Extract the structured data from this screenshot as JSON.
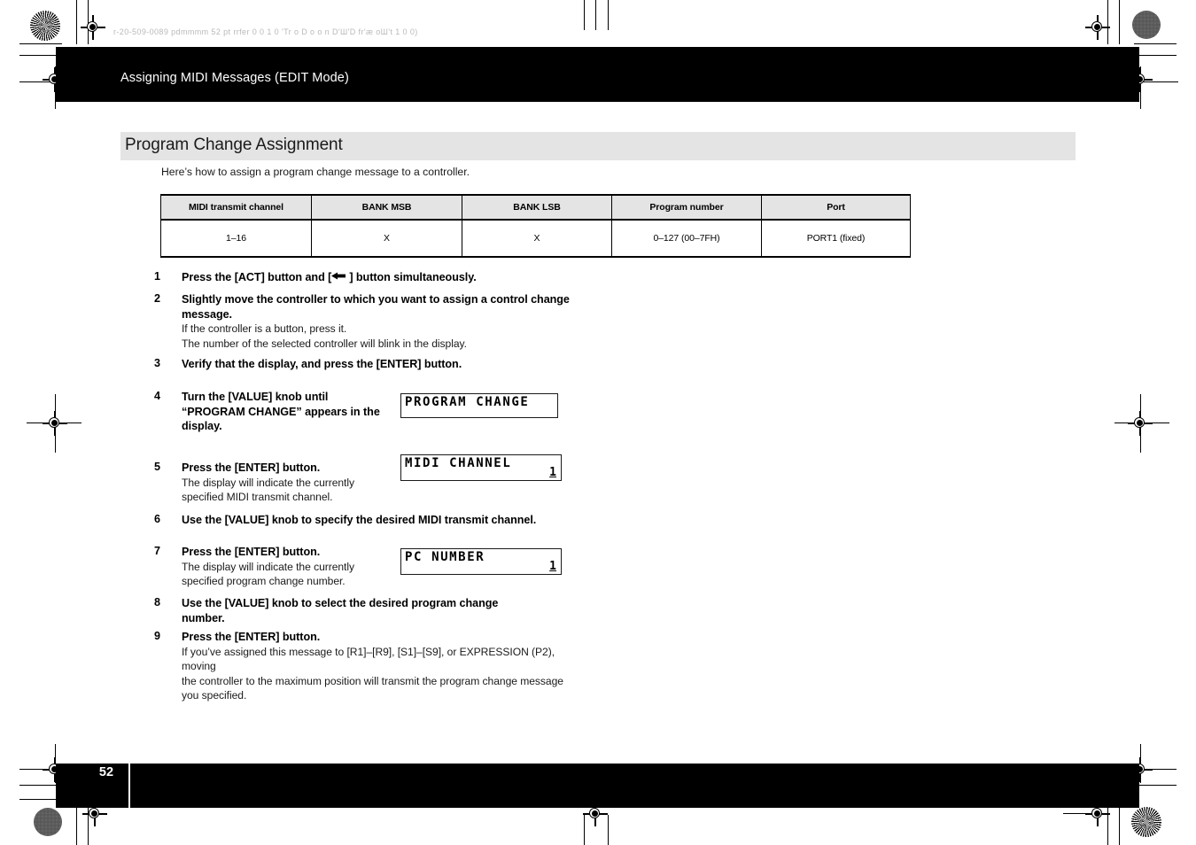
{
  "header": {
    "title": "Assigning MIDI Messages (EDIT Mode)",
    "faint_line": "r-20-509-0089    pdmmmm 52 pt rrfer   0 0 1 0 'Tr o D o o n   D'Ш'D   fr'æ oШ't 1 0 0)"
  },
  "footer": {
    "page_number": "52"
  },
  "section": {
    "title": "Program Change Assignment",
    "intro": "Here’s how to assign a program change message to a controller."
  },
  "spec_table": {
    "headers": [
      "MIDI transmit channel",
      "BANK MSB",
      "BANK LSB",
      "Program number",
      "Port"
    ],
    "rows": [
      [
        "1–16",
        "X",
        "X",
        "0–127 (00–7FH)",
        "PORT1 (fixed)"
      ]
    ]
  },
  "steps": [
    {
      "num": "1",
      "head_before": "Press the [ACT] button and [",
      "icon": "left-triangle-arrow",
      "head_after": "] button simultaneously.",
      "sub": []
    },
    {
      "num": "2",
      "head": "Slightly move the controller to which you want to assign a control change message.",
      "sub": [
        "If the controller is a button, press it.",
        "The number of the selected controller will blink in the display."
      ]
    },
    {
      "num": "3",
      "head": "Verify that the display, and press the [ENTER] button.",
      "sub": []
    },
    {
      "num": "4",
      "head": "Turn the [VALUE] knob until “PROGRAM CHANGE” appears in the display.",
      "sub": []
    },
    {
      "num": "5",
      "head": "Press the [ENTER] button.",
      "sub": [
        "The display will indicate the currently",
        "specified MIDI transmit channel."
      ]
    },
    {
      "num": "6",
      "head": "Use the [VALUE] knob to specify the desired MIDI transmit channel.",
      "sub": []
    },
    {
      "num": "7",
      "head": "Press the [ENTER] button.",
      "sub": [
        "The display will indicate the currently",
        "specified program change number."
      ]
    },
    {
      "num": "8",
      "head": "Use the [VALUE] knob to select the desired program change number.",
      "sub": []
    },
    {
      "num": "9",
      "head": "Press the [ENTER] button.",
      "sub": [
        "If you’ve assigned this message to [R1]–[R9], [S1]–[S9], or EXPRESSION (P2), moving",
        "the controller to the maximum position will transmit the program change message",
        "you specified."
      ]
    }
  ],
  "lcd_displays": [
    {
      "line1": "PROGRAM CHANGE",
      "line2": ""
    },
    {
      "line1": "MIDI CHANNEL",
      "line2": "1"
    },
    {
      "line1": "PC NUMBER",
      "line2": "1"
    }
  ],
  "colors": {
    "bar_black": "#000000",
    "band_gray": "#e4e4e4",
    "text_black": "#000000",
    "page_white": "#ffffff"
  }
}
